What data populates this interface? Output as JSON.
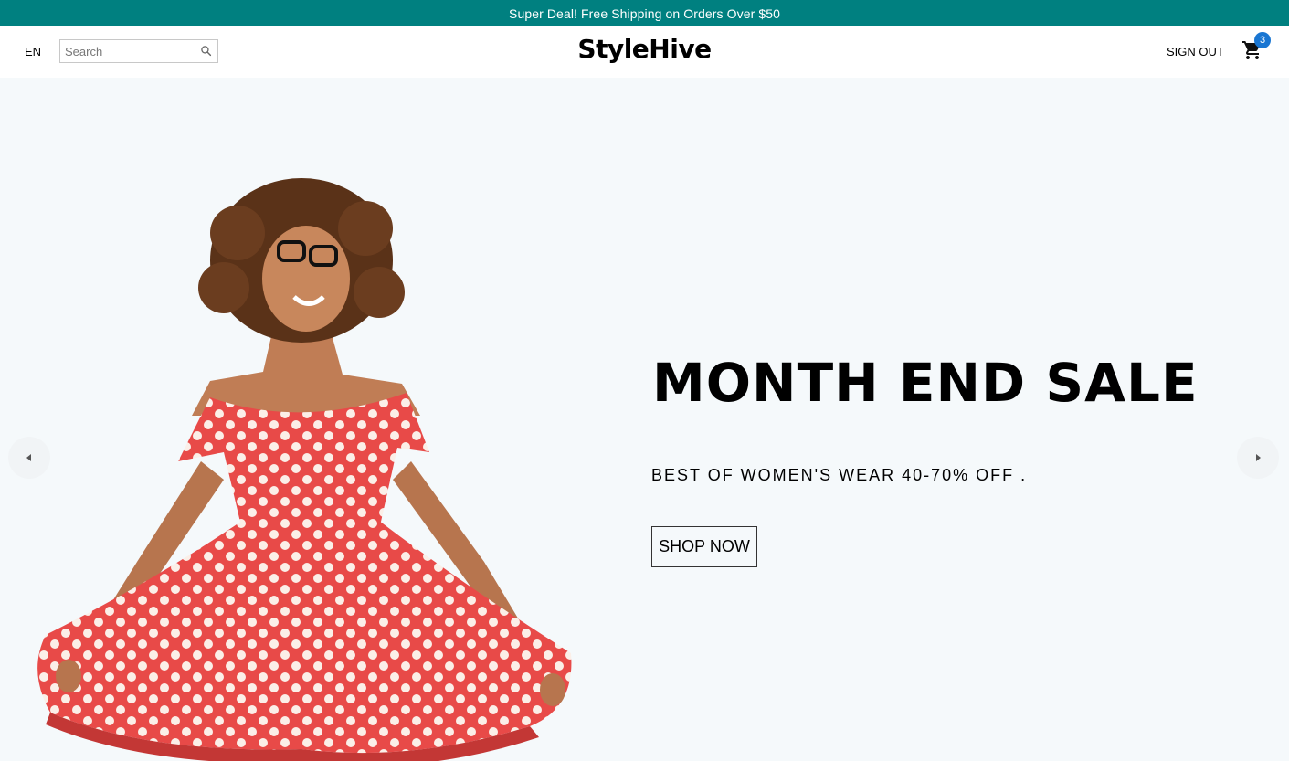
{
  "announcement": {
    "text": "Super Deal! Free Shipping on Orders Over $50",
    "bg_color": "#008080"
  },
  "header": {
    "language": "EN",
    "search": {
      "placeholder": "Search",
      "value": "",
      "icon": "search-icon"
    },
    "logo": "StyleHive",
    "sign_out": "SIGN OUT",
    "cart": {
      "icon": "shopping-cart-icon",
      "count": "3",
      "badge_color": "#1976d2"
    }
  },
  "hero": {
    "title": "MONTH END SALE",
    "subtitle": "BEST OF WOMEN'S WEAR 40-70% OFF .",
    "cta": "SHOP NOW",
    "image": "woman-in-red-polka-dot-dress",
    "prev_icon": "caret-left-icon",
    "next_icon": "caret-right-icon",
    "bg_color": "#f5f9fb"
  }
}
